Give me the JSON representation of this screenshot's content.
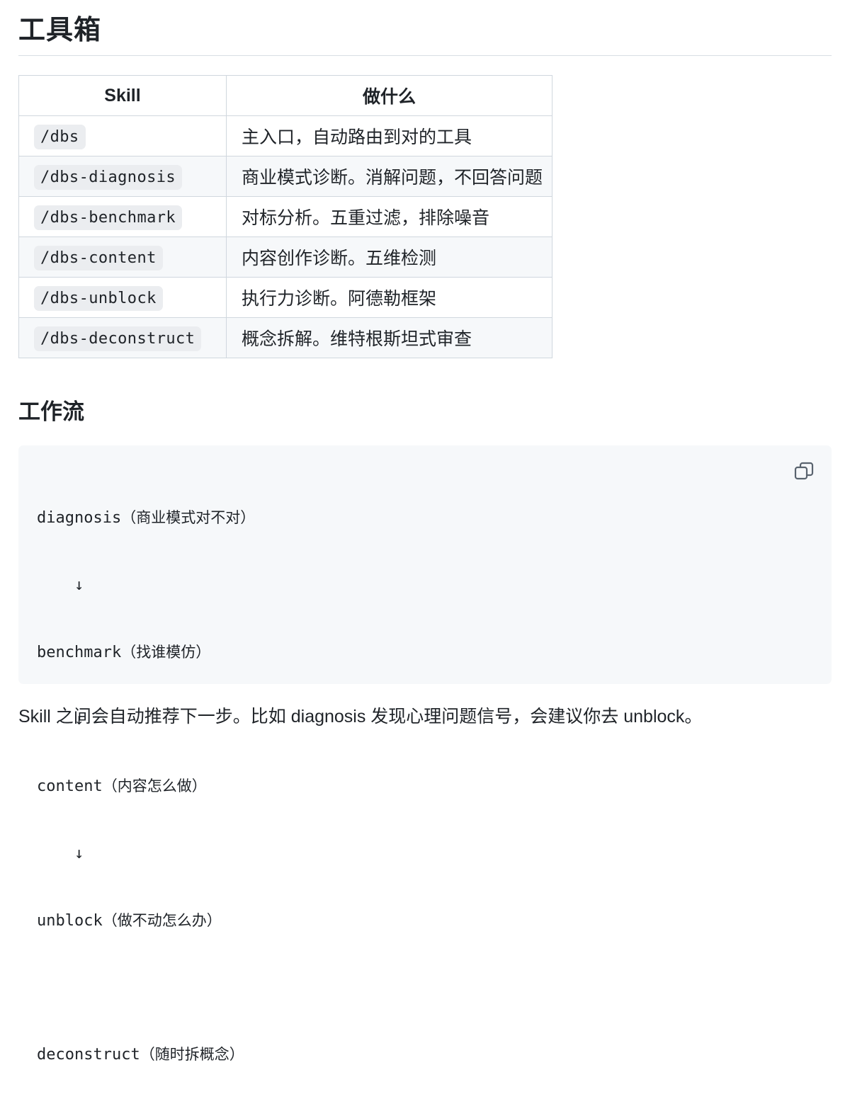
{
  "heading": "工具箱",
  "table": {
    "headers": [
      "Skill",
      "做什么"
    ],
    "rows": [
      {
        "skill": "/dbs",
        "desc": "主入口，自动路由到对的工具"
      },
      {
        "skill": "/dbs-diagnosis",
        "desc": "商业模式诊断。消解问题，不回答问题"
      },
      {
        "skill": "/dbs-benchmark",
        "desc": "对标分析。五重过滤，排除噪音"
      },
      {
        "skill": "/dbs-content",
        "desc": "内容创作诊断。五维检测"
      },
      {
        "skill": "/dbs-unblock",
        "desc": "执行力诊断。阿德勒框架"
      },
      {
        "skill": "/dbs-deconstruct",
        "desc": "概念拆解。维特根斯坦式审查"
      }
    ]
  },
  "workflow": {
    "heading": "工作流",
    "lines": [
      {
        "cmd": "diagnosis",
        "note": "（商业模式对不对）"
      },
      {
        "arrow": "    ↓"
      },
      {
        "cmd": "benchmark",
        "note": "（找谁模仿）"
      },
      {
        "arrow": "    ↓"
      },
      {
        "cmd": "content",
        "note": "（内容怎么做）"
      },
      {
        "arrow": "    ↓"
      },
      {
        "cmd": "unblock",
        "note": "（做不动怎么办）"
      },
      {
        "blank": ""
      },
      {
        "cmd": "deconstruct",
        "note": "（随时拆概念）"
      }
    ],
    "copy_icon": "copy-icon"
  },
  "footer_text": "Skill 之间会自动推荐下一步。比如 diagnosis 发现心理问题信号，会建议你去 unblock。"
}
